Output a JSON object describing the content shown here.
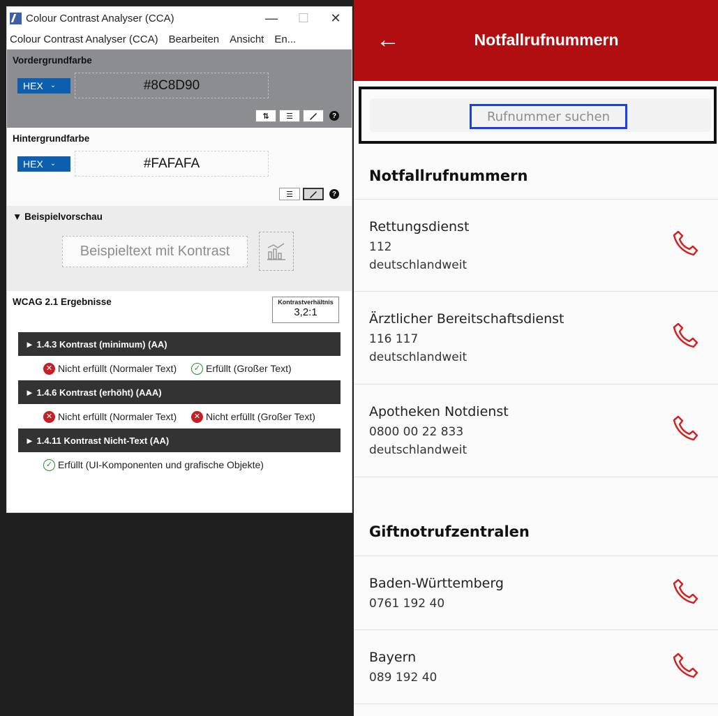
{
  "cca": {
    "title": "Colour Contrast Analyser (CCA)",
    "window_controls": {
      "minimize": "—",
      "maximize": "☐",
      "close": "✕"
    },
    "menu": [
      "Colour Contrast Analyser (CCA)",
      "Bearbeiten",
      "Ansicht",
      "En..."
    ],
    "foreground": {
      "label": "Vordergrundfarbe",
      "format": "HEX",
      "value": "#8C8D90",
      "color": "#8c8d90"
    },
    "background": {
      "label": "Hintergrundfarbe",
      "format": "HEX",
      "value": "#FAFAFA",
      "color": "#fafafa"
    },
    "preview": {
      "label": "▼ Beispielvorschau",
      "sample_text": "Beispieltext mit Kontrast"
    },
    "results": {
      "label": "WCAG 2.1 Ergebnisse",
      "ratio_label": "Kontrastverhältnis",
      "ratio_value": "3,2:1",
      "criteria": [
        {
          "title": "► 1.4.3 Kontrast (minimum) (AA)",
          "normal": "Nicht erfüllt (Normaler Text)",
          "large": "Erfüllt (Großer Text)"
        },
        {
          "title": "► 1.4.6 Kontrast (erhöht) (AAA)",
          "normal": "Nicht erfüllt (Normaler Text)",
          "large": "Nicht erfüllt (Großer Text)"
        },
        {
          "title": "► 1.4.11 Kontrast Nicht-Text (AA)",
          "ui": "Erfüllt (UI-Komponenten und grafische Objekte)"
        }
      ]
    }
  },
  "app": {
    "title": "Notfallrufnummern",
    "brand_color": "#b10e12",
    "search_placeholder": "Rufnummer suchen",
    "groups": [
      {
        "title": "Notfallrufnummern",
        "items": [
          {
            "name": "Rettungsdienst",
            "number": "112",
            "region": "deutschlandweit"
          },
          {
            "name": "Ärztlicher Bereitschaftsdienst",
            "number": "116 117",
            "region": "deutschlandweit"
          },
          {
            "name": "Apotheken Notdienst",
            "number": "0800 00 22 833",
            "region": "deutschlandweit"
          }
        ]
      },
      {
        "title": "Giftnotrufzentralen",
        "items": [
          {
            "name": "Baden-Württemberg",
            "number": "0761 192 40"
          },
          {
            "name": "Bayern",
            "number": "089 192 40"
          }
        ]
      }
    ]
  }
}
